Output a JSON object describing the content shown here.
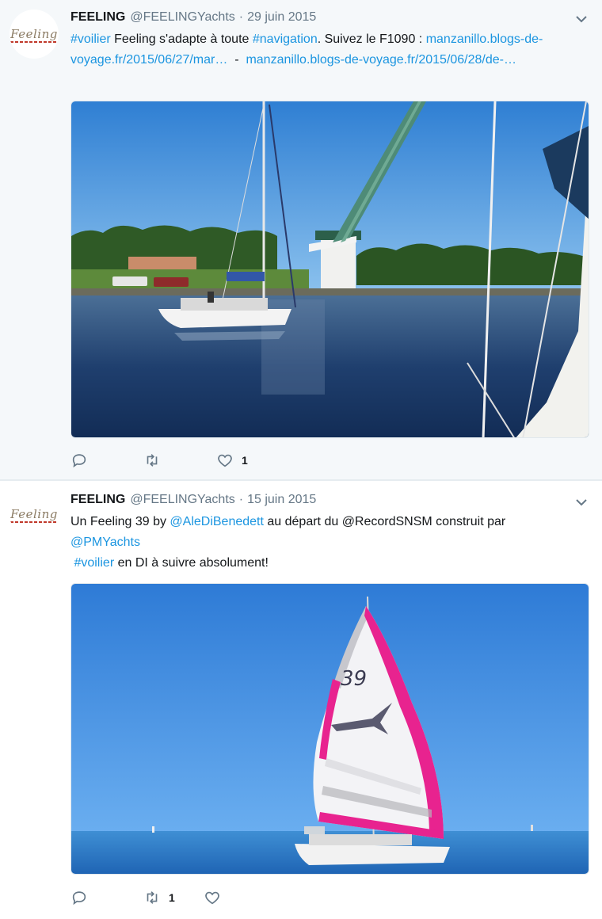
{
  "tweets": [
    {
      "avatar_text": "Feeling",
      "name": "FEELING",
      "handle": "@FEELINGYachts",
      "separator": "·",
      "date": "29 juin 2015",
      "text": {
        "hashtag1": "#voilier",
        "part1": " Feeling s'adapte à toute ",
        "hashtag2": "#navigation",
        "part2": ". Suivez le F1090 : ",
        "link1": "manzanillo.blogs-de-voyage.fr/2015/06/27/mar…",
        "dash": "  -  ",
        "link2": "manzanillo.blogs-de-voyage.fr/2015/06/28/de-…"
      },
      "actions": {
        "reply_count": "",
        "retweet_count": "",
        "like_count": "1"
      }
    },
    {
      "avatar_text": "Feeling",
      "name": "FEELING",
      "handle": "@FEELINGYachts",
      "separator": "·",
      "date": "15 juin 2015",
      "text": {
        "part1": "Un Feeling 39 by ",
        "mention1": "@AleDiBenedett",
        "part2": " au départ du ",
        "mention2": "@RecordSNSM",
        "part3": " construit par ",
        "mention3": "@PMYachts",
        "hashtag1": "#voilier",
        "part4": " en DI à suivre absolument!"
      },
      "sail_number": "39",
      "actions": {
        "reply_count": "",
        "retweet_count": "1",
        "like_count": ""
      }
    }
  ],
  "colors": {
    "link": "#1b95e0",
    "muted": "#657786",
    "text": "#14171a",
    "spinnaker_pink": "#e8238f"
  }
}
